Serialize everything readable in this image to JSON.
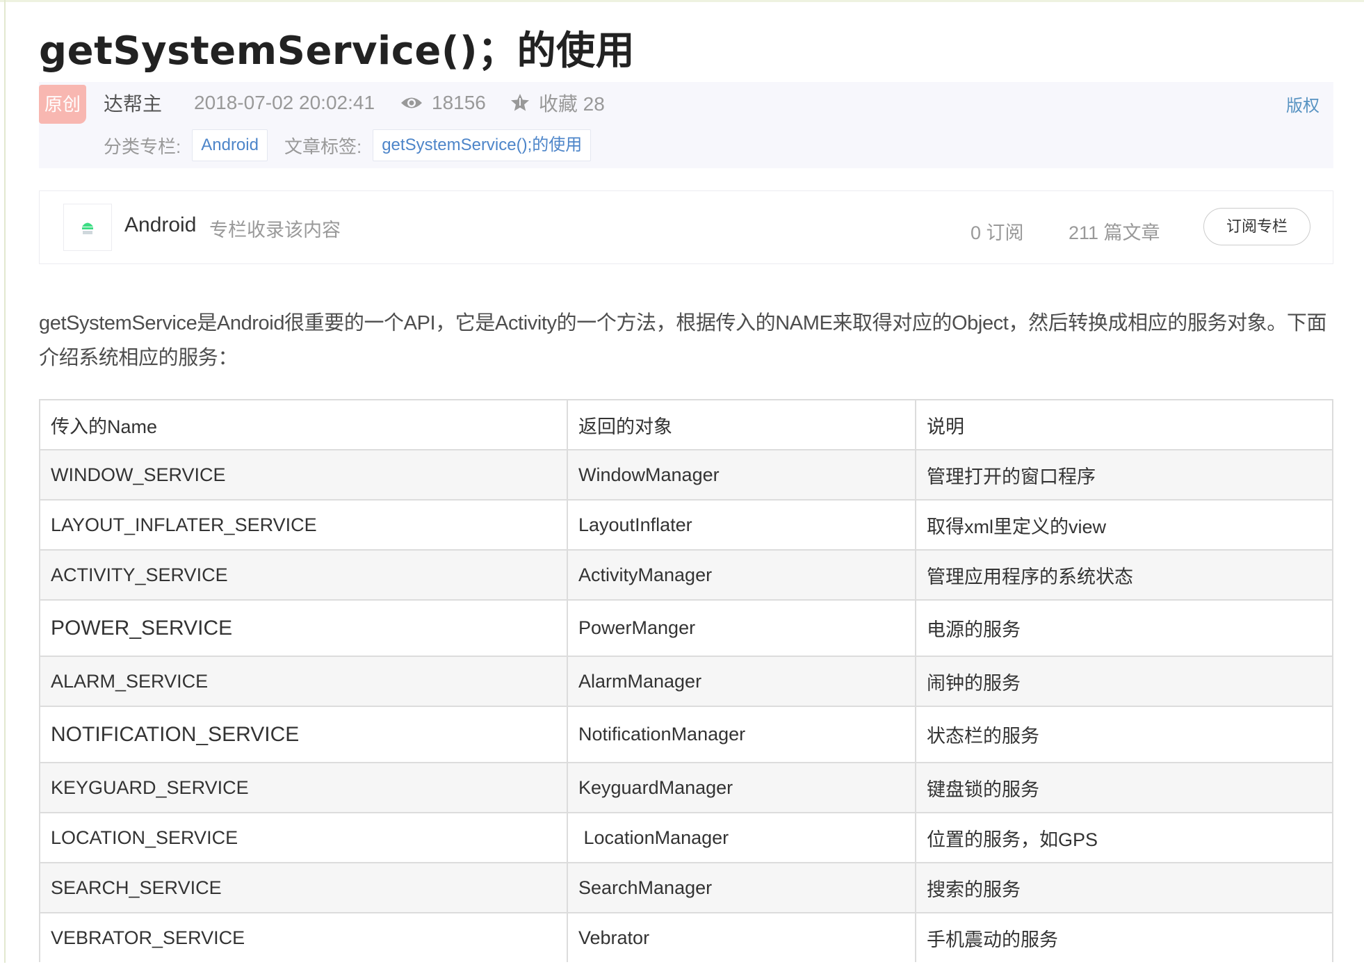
{
  "article": {
    "title": "getSystemService()；的使用",
    "badge": "原创",
    "author": "达帮主",
    "date": "2018-07-02 20:02:41",
    "views": "18156",
    "favorites": "收藏 28",
    "copyright": "版权",
    "category_label": "分类专栏:",
    "category_tag": "Android",
    "tags_label": "文章标签:",
    "tag": "getSystemService();的使用"
  },
  "column": {
    "name": "Android",
    "desc": "专栏收录该内容",
    "subscribers": "0 订阅",
    "posts": "211 篇文章",
    "subscribe_button": "订阅专栏"
  },
  "intro": "getSystemService是Android很重要的一个API，它是Activity的一个方法，根据传入的NAME来取得对应的Object，然后转换成相应的服务对象。下面介绍系统相应的服务：",
  "table": {
    "headers": [
      "传入的Name",
      "返回的对象",
      "说明"
    ],
    "rows": [
      [
        "WINDOW_SERVICE",
        "WindowManager",
        "管理打开的窗口程序"
      ],
      [
        "LAYOUT_INFLATER_SERVICE",
        "LayoutInflater",
        "取得xml里定义的view"
      ],
      [
        "ACTIVITY_SERVICE",
        "ActivityManager",
        "管理应用程序的系统状态"
      ],
      [
        "POWER_SERVICE",
        "PowerManger",
        "电源的服务"
      ],
      [
        "ALARM_SERVICE",
        "AlarmManager",
        "闹钟的服务"
      ],
      [
        "NOTIFICATION_SERVICE",
        "NotificationManager",
        "状态栏的服务"
      ],
      [
        "KEYGUARD_SERVICE",
        "KeyguardManager",
        "键盘锁的服务"
      ],
      [
        "LOCATION_SERVICE",
        " LocationManager",
        "位置的服务，如GPS"
      ],
      [
        "SEARCH_SERVICE",
        "SearchManager",
        "搜索的服务"
      ],
      [
        "VEBRATOR_SERVICE",
        "Vebrator",
        "手机震动的服务"
      ]
    ]
  },
  "icons": [
    "eye-icon",
    "star-icon",
    "android-icon"
  ],
  "colors": {
    "badge": "#f8b7b1",
    "link": "#4d85c9",
    "meta_bg": "#f7f7fc"
  }
}
